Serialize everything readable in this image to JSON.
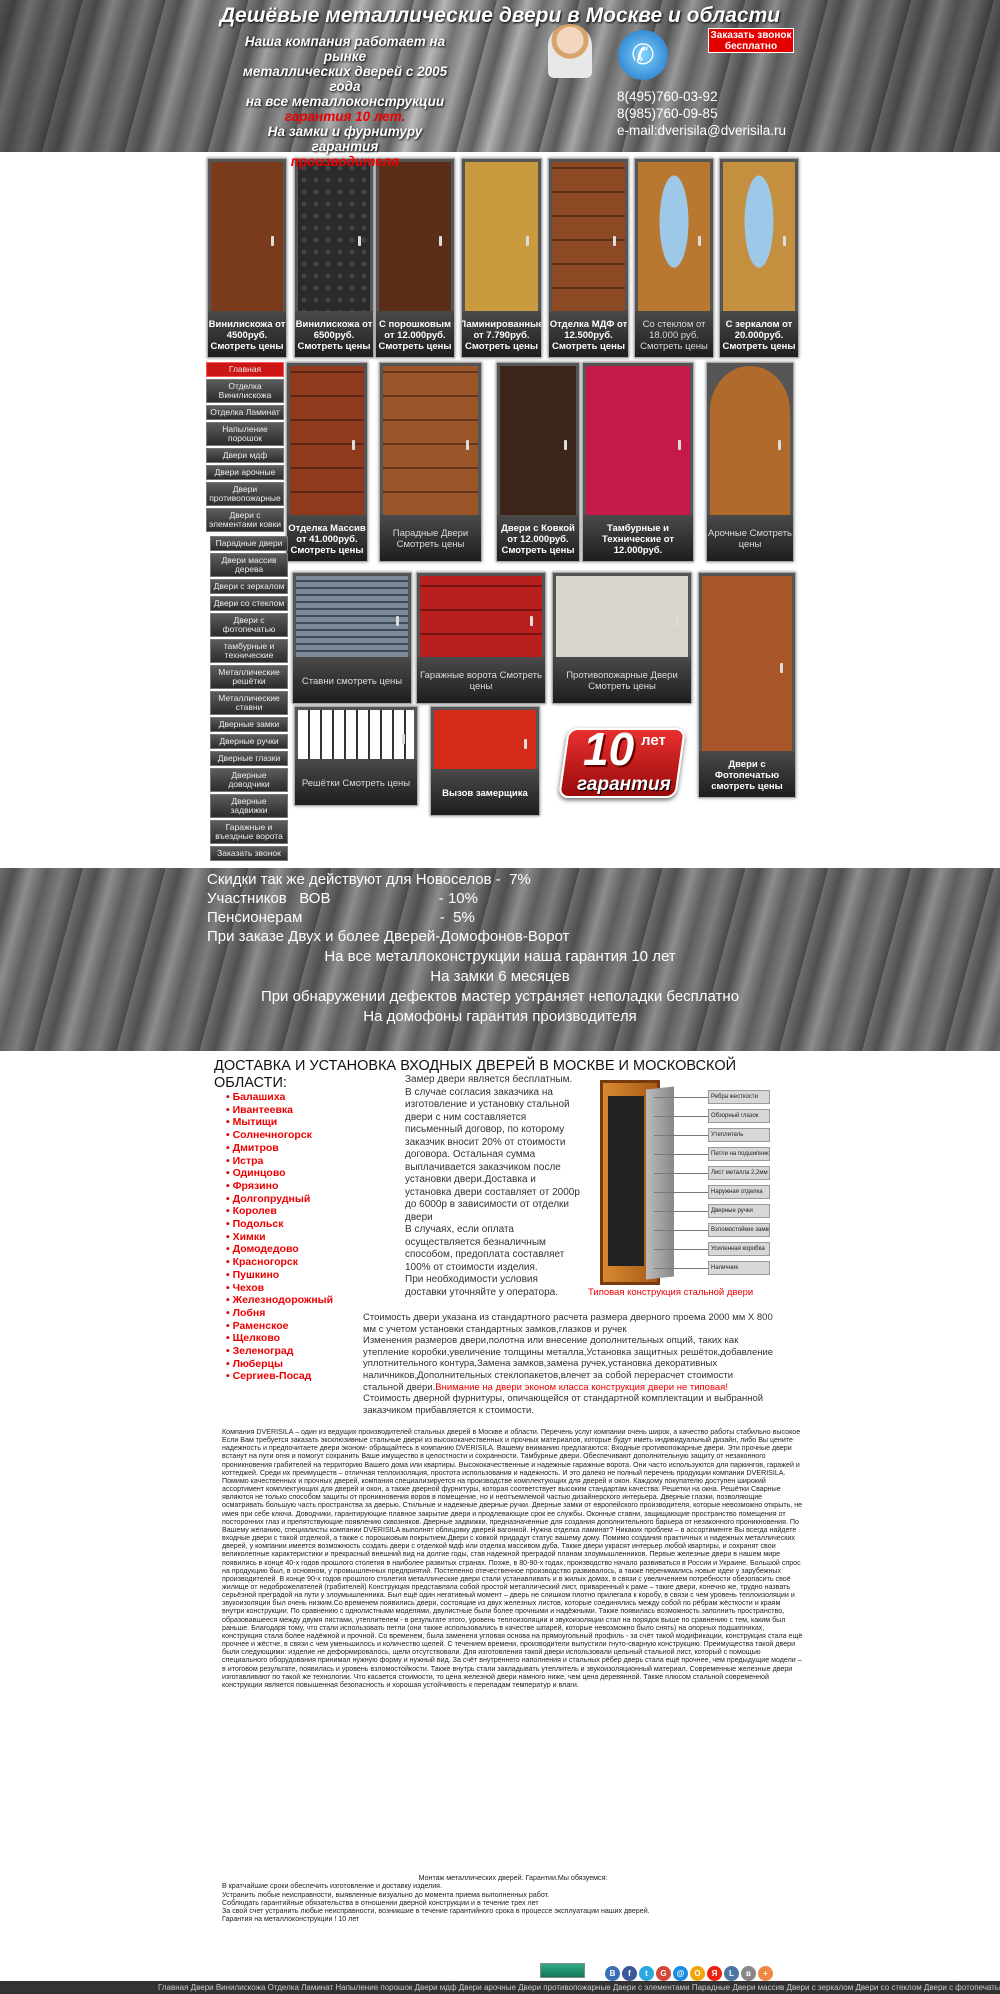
{
  "header": {
    "title": "Дешёвые металлические двери в Москве и области",
    "about_line1": "Наша компания работает на рынке",
    "about_line2": "металлических дверей  с 2005 года",
    "about_line3": "на все металлоконструкции",
    "about_guarantee": "гарантия 10 лет.",
    "about_line5": "На замки и фурнитуру гарантия",
    "about_producer": "производителя",
    "callback_label": "Заказать звонок бесплатно",
    "phone1": "8(495)760-03-92",
    "phone2": "8(985)760-09-85",
    "email": "e-mail:dverisila@dverisila.ru"
  },
  "doors_row1": [
    {
      "label": "Винилискожа от 4500руб. Смотреть цены",
      "color": "#7a3a1c"
    },
    {
      "label": "Винилискожа от 6500руб. Смотреть цены",
      "color": "#2a2a2a"
    },
    {
      "label": "С порошковым от 12.000руб. Смотреть цены",
      "color": "#5a2e18"
    },
    {
      "label": "Ламинированные от 7.790руб. Смотреть цены",
      "color": "#c99a3e"
    },
    {
      "label": "Отделка МДФ от 12.500руб. Смотреть цены",
      "color": "#8b4a23"
    },
    {
      "label": "Со стеклом от 18.000 руб. Смотреть цены",
      "color": "#b9782f"
    },
    {
      "label": "С зеркалом от 20.000руб. Смотреть цены",
      "color": "#c4903f"
    }
  ],
  "doors_row2": [
    {
      "label": "Отделка Массив от 41.000руб. Смотреть цены",
      "color": "#8f3a1c"
    },
    {
      "label": "Парадные Двери Смотреть цены",
      "color": "#9a5628"
    },
    {
      "label": "Двери с Ковкой от 12.000руб. Смотреть цены",
      "color": "#3c2418"
    },
    {
      "label": "Тамбурные и Технические от 12.000руб.",
      "color": "#c41a4a"
    },
    {
      "label": "Арочные Смотреть цены",
      "color": "#b06a2c"
    }
  ],
  "doors_row3": [
    {
      "label": "Ставни смотреть цены",
      "color": "#5e6c7a"
    },
    {
      "label": "Гаражные ворота Смотреть цены",
      "color": "#b82020"
    },
    {
      "label": "Противопожарные Двери Смотреть цены",
      "color": "#d8d6cc"
    },
    {
      "label": "Двери с Фотопечатью смотреть цены",
      "color": "#a8562a"
    }
  ],
  "doors_row4": [
    {
      "label": "Решётки Смотреть цены",
      "color": "#e8e8e8"
    },
    {
      "label": "Вызов замерщика",
      "color": "#d42a1a"
    }
  ],
  "guarantee_badge": {
    "number": "10",
    "years": "лет",
    "word": "гарантия"
  },
  "menu": [
    {
      "label": "Главная",
      "active": true
    },
    {
      "label": "Отделка Винилискожа"
    },
    {
      "label": "Отделка Ламинат"
    },
    {
      "label": "Напыление порошок"
    },
    {
      "label": "Двери мдф"
    },
    {
      "label": "Двери арочные"
    },
    {
      "label": "Двери противопожарные"
    },
    {
      "label": "Двери с элементами ковки"
    },
    {
      "label": "Парадные двери"
    },
    {
      "label": "Двери массив дерева"
    },
    {
      "label": "Двери с зеркалом"
    },
    {
      "label": "Двери со стеклом"
    },
    {
      "label": "Двери с фотопечатью"
    },
    {
      "label": "тамбурные и технические"
    },
    {
      "label": "Металлические решётки"
    },
    {
      "label": "Металлические ставни"
    },
    {
      "label": "Дверные замки"
    },
    {
      "label": "Дверные ручки"
    },
    {
      "label": "Дверные глазки"
    },
    {
      "label": "Дверные доводчики"
    },
    {
      "label": "Дверные задвижки"
    },
    {
      "label": "Гаражные и въездные ворота"
    },
    {
      "label": "Заказать звонок"
    }
  ],
  "discounts": {
    "l1": "Скидки так же действуют для Новоселов -  7%",
    "l2": "Участников   ВОВ                          - 10%",
    "l3": "Пенсионерам                                 -  5%",
    "l4": "При заказе Двух и более Дверей-Домофонов-Ворот",
    "c1": "На все металлоконструкции наша гарантия 10 лет",
    "c2": "На замки 6 месяцев",
    "c3": "При обнаружении дефектов мастер устраняет неполадки бесплатно",
    "c4": "На домофоны гарантия производителя"
  },
  "delivery": {
    "title": "ДОСТАВКА И УСТАНОВКА ВХОДНЫХ ДВЕРЕЙ В МОСКВЕ И МОСКОВСКОЙ ОБЛАСТИ:",
    "cities": [
      "Балашиха",
      "Ивантеевка",
      "Мытищи",
      "Солнечногорск",
      "Дмитров",
      "Истра",
      "Одинцово",
      "Фрязино",
      "Долгопрудный",
      "Королев",
      "Подольск",
      "Химки",
      "Домодедово",
      "Красногорск",
      "Пушкино",
      "Чехов",
      "Железнодорожный",
      "Лобня",
      "Раменское",
      "Щелково",
      "Зеленоград",
      "Люберцы",
      "Сергиев-Посад"
    ],
    "measure_text": "Замер двери является бесплатным. В случае согласия заказчика на изготовление и установку стальной двери с ним составляется письменный договор, по которому заказчик вносит 20% от стоимости договора. Остальная сумма выплачивается заказчиком после установки двери.Доставка и установка двери составляет от 2000р до 6000р в зависимости от отделки двери",
    "measure_text2": "В случаях, если оплата осуществляется безналичным способом, предоплата составляет 100% от стоимости изделия.",
    "measure_text3": "При необходимости условия доставки уточняйте у оператора.",
    "scheme_caption": "Типовая конструкция стальной двери",
    "scheme_labels": [
      "Ребра жесткости",
      "Обзорный глазок",
      "Утеплитель",
      "Петли на подшипниках",
      "Лист металла 2,2мм",
      "Наружная отделка",
      "Дверные ручки",
      "Взломостойкие замки",
      "Усиленная коробка",
      "Наличник"
    ]
  },
  "price": {
    "p1": "Стоимость двери указана из стандартного расчета размера дверного проема 2000 мм Х 800 мм с учетом установки стандартных замков,глазков и ручек",
    "p2": "Изменения размеров двери,полотна или внесение дополнительных опций, таких как утепление коробки,увеличение толщины металла,Установка защитных решёток,добавление уплотнительного контура,Замена замков,замена ручек,установка декоративных наличников,Дополнительных стеклопакетов,влечет за собой перерасчет стоимости стальной  двери.",
    "p2_red": "Внимание на двери эконом класса конструкция двери не типовая!",
    "p3": "Стоимость дверной фурнитуры, опичающейся от стандартной комплектации и выбранной заказчиком прибавляется к стоимости."
  },
  "about_text": "Компания DVERISILA – один из ведущих производителей стальных дверей в Москве и области. Перечень услуг компании очень широк, а качество работы стабильно высокое Если Вам требуется заказать эксклюзивные стальные двери из высококачественных и прочных материалов, которые будут иметь индивидуальный дизайн, либо Вы цените надежность и предпочитаете двери эконом- обращайтесь в компанию DVERISILA. Вашему вниманию предлагаются: Входные противопожарные двери. Эти прочные двери встанут на пути огня и помогут сохранить Ваше имущество в целостности и сохранности. Тамбурные двери. Обеспечивают дополнительную защиту от незаконного проникновения грабителей на территорию Вашего дома или квартиры. Высококачественные и надежные гаражные ворота. Они часто используются для паркингов, гаражей и коттеджей. Среди их преимуществ – отличная теплоизоляция, простота использования и надежность. И это далеко не полный перечень продукции компании DVERISILA. Помимо качественных и прочных дверей, компания специализируется на производстве комплектующих для дверей и окон. Каждому покупателю доступен широкий ассортимент комплектующих для дверей и окон, а также дверной фурнитуры, которая соответствует высоким стандартам качества: Решетки на окна. Решётки Сварные являются не только способом защиты от проникновения воров в помещение, но и неотъемлемой частью дизайнерского интерьера. Дверные глазки, позволяющие осматривать большую часть пространства за дверью. Стильные и надежные дверные ручки. Дверные замки от европейского производителя, которые невозможно открыть, не имея при себе ключа. Доводчики, гарантирующие плавное закрытие двери и продлевающие срок ее службы. Оконные ставни, защищающие пространство помещения от посторонних глаз и препятствующие появлению сквозняков. Дверные задвижки, предназначенные для создания дополнительного барьера от незаконного проникновения. По Вашему желанию, специалисты компании DVERISILA выполнят облицовку дверей вагонкой. Нужна отделка ламинат? Никаких проблем – в ассортименте Вы всегда найдете входные двери с такой отделкой, а также с порошковым покрытием.Двери с ковкой придадут статус вашему дому. Помимо создания практичных и надежных металлических дверей, у компании имеется возможность создать двери с отделкой мдф или отделка массивом дуба. Также двери украсят интерьер любой квартиры, и сохранят свои великолепные характеристики и прекрасный внешний вид на долгие годы, став надежной преградой планам злоумышленников. Первые железные двери в нашем мире появились в конце 40-х годов прошлого столетия в наиболее развитых странах. Позже, в 80-90-х годах, производство начало развиваться в России и Украине. Большой спрос на продукцию был, в основном, у промышленных предприятий. Постепенно отечественное производство развивалось, а также перенимались новые идеи у зарубежных производителей. В конце 90-х годов прошлого столетия металлические двери стали устанавливать и в жилых домах, в связи с увеличением потребности обезопасить своё жилище от недоброжелателей (грабителей) Конструкция представляла собой простой металлический лист, приваренный к раме – такие двери, конечно же, трудно назвать серьёзной преградой на пути у злоумышленника. Был ещё один негативный момент – дверь не слишком плотно прилегала к коробу, в связи с чем уровень теплоизоляции и звукоизоляции был очень низким.Со временем появились двери, состоящие из двух железных листов, которые соединялись между собой по рёбрам жёсткости и краям внутри конструкции. По сравнению с однолистными моделями, двулистные были более прочными и надёжными. Также появилась возможность заполнить пространство, образовавшееся между двумя листами, утеплителем - в результате этого, уровень теплоизоляции и звукоизоляции стал на порядок выше по сравнению с тем, каким был раньше. Благодаря тому, что стали использовать петли (они также использовались в качестве шпарей, которые невозможно было снять) на опорных подшипниках, конструкция стала более надёжной и прочной. Со временем, была заменена угловая основа на прямоугольный профиль - за счёт такой модификации, конструкция стала ещё прочнее и жёстче, в связи с чем уменьшилось и количество щелей. С течением времени, производители выпустили гнуто-сварную конструкцию. Преимущества такой двери были следующими: изделие не деформировалось, щели отсутствовали. Для изготовления такой двери использовали цельный стальной лист, который с помощью специального оборудования принимал нужную форму и нужный вид. За счёт внутреннего наполнения и стальных рёбер дверь стала ещё прочнее, чем предыдущие модели – в итоговом результате, появилась и уровень взломостойкости. Также внутрь стали закладывать утеплитель и звукоизоляционный материал. Современные железные двери изготавливают по такой же технологии. Что касается стоимости, то цена железной двери намного ниже, чем цена деревянной. Также плюсом стальной современной конструкции является повышенная безопасность и хорошая устойчивость к перепадам температур и влаги.",
  "guarantee_text": {
    "title": "Монтаж металлических дверей. Гарантии.Мы обязуемся:",
    "l1": "В кратчайшие сроки обеспечить изготовление и доставку изделия.",
    "l2": "Устранить любые неисправности, выявленные визуально до момента приема выполненных работ.",
    "l3": "Соблюдать гарантийные обязательства в отношении дверной конструкции и в течение трех лет",
    "l4": "За свой счет устранить любые неисправности, возникшие в течение гарантийного срока в процессе эксплуатации наших дверей.",
    "l5": "Гарантия на металлоконструкции ! 10 лет"
  },
  "share_icons": [
    "В",
    "f",
    "t",
    "G",
    "@",
    "О",
    "Я",
    "L",
    "в",
    "+"
  ],
  "share_colors": [
    "#3d6fb5",
    "#3b5998",
    "#2aa9e0",
    "#d34836",
    "#168de2",
    "#f2a50c",
    "#e21",
    "#4c75a3",
    "#888",
    "#e84"
  ],
  "bottom_bar": "Главная Двери Винилискожа Отделка Ламинат Напыление порошок Двери мдф Двери арочные Двери противопожарные Двери с элементами Парадные Двери массив Двери с зеркалом Двери со стеклом Двери с фотопечатью Тамбурные и технические"
}
